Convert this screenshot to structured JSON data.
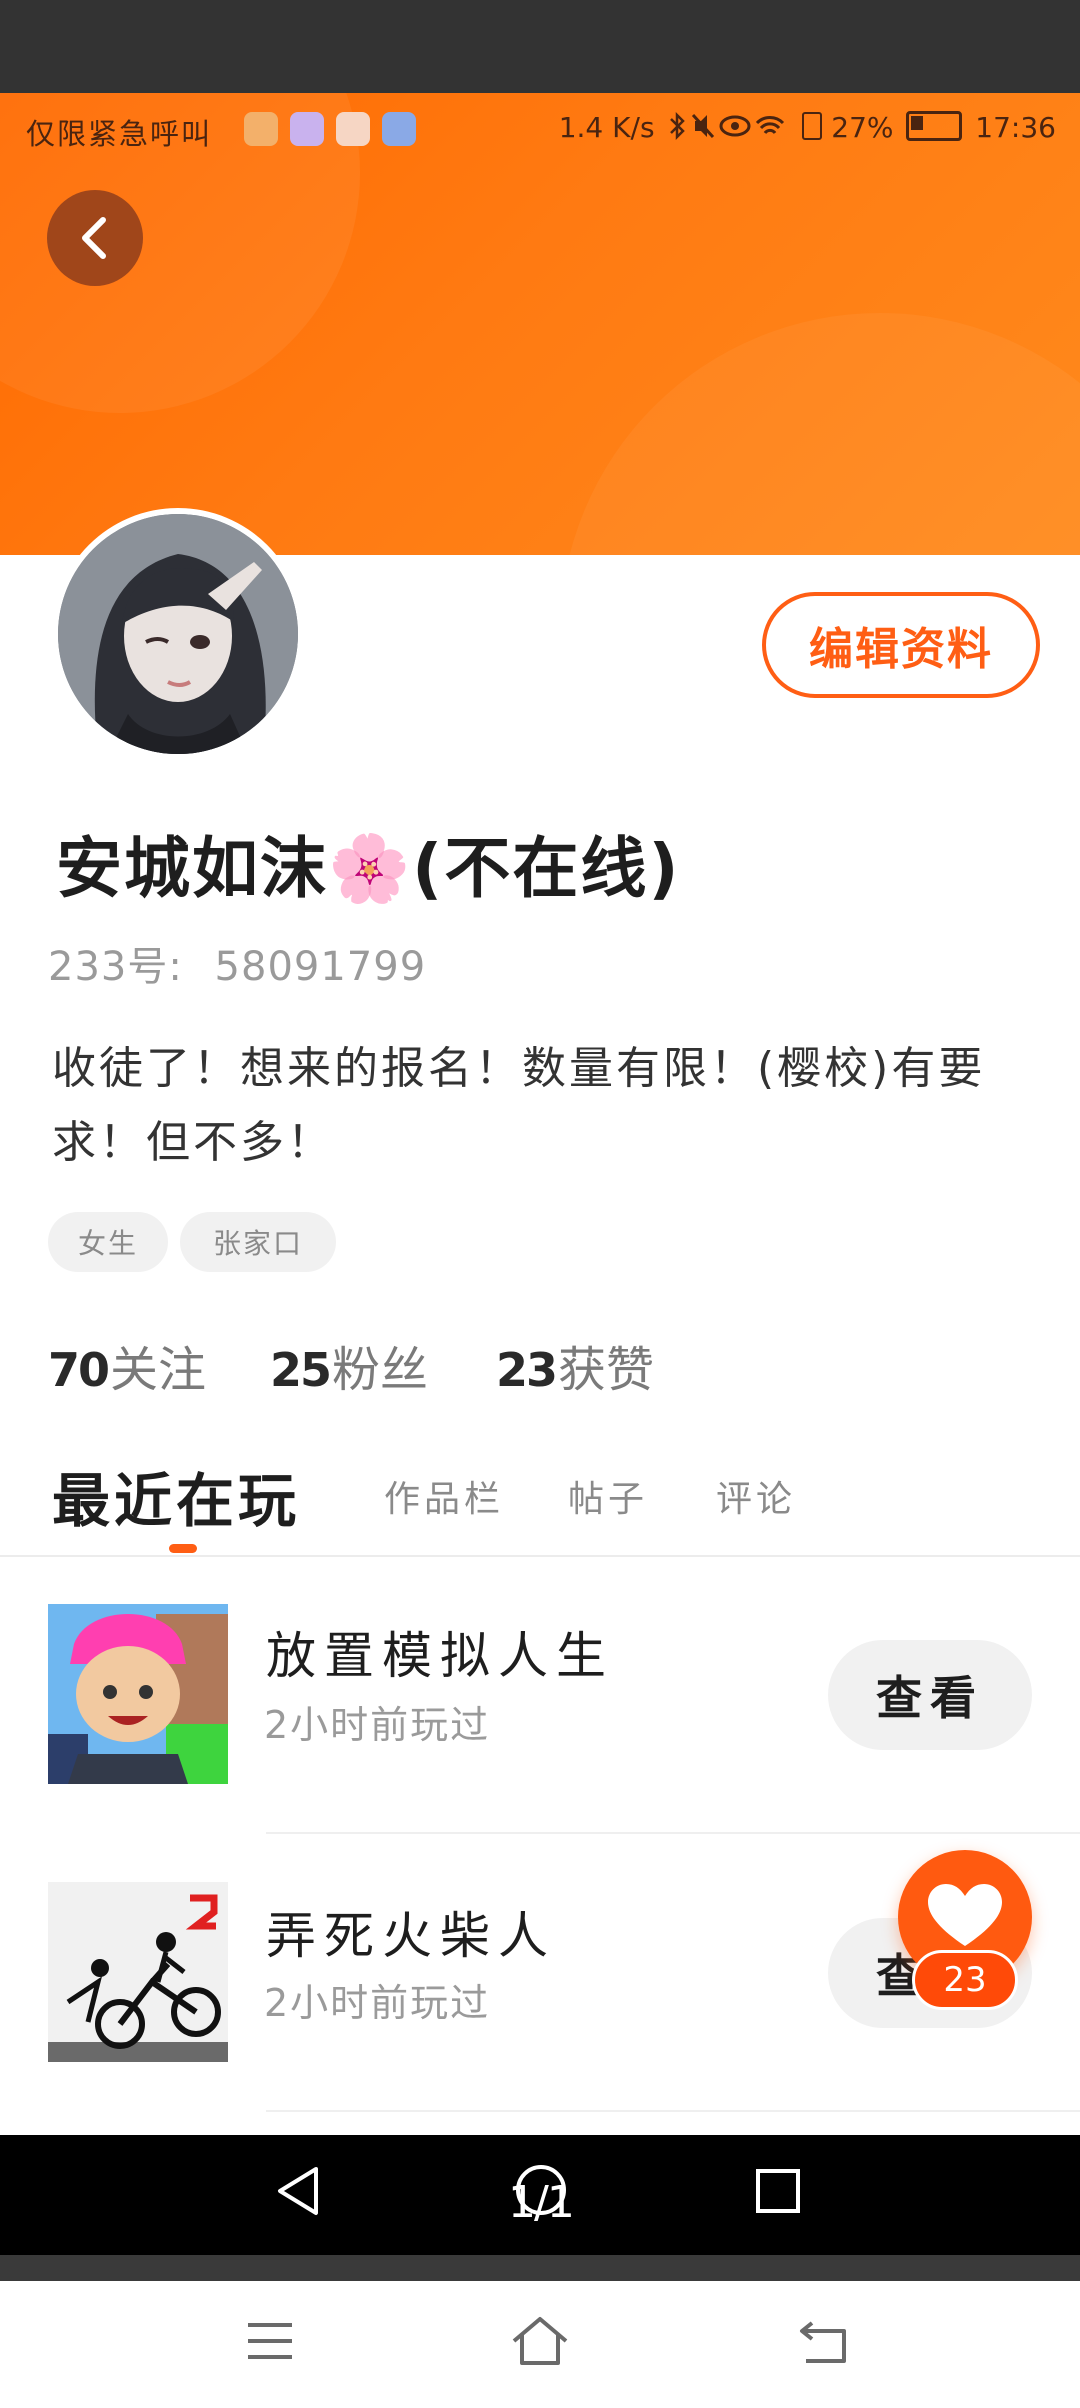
{
  "status_bar": {
    "left_text": "仅限紧急呼叫",
    "speed": "1.4 K/s",
    "battery": "27%",
    "time": "17:36"
  },
  "profile": {
    "edit_label": "编辑资料",
    "username": "安城如沫🌸(不在线)",
    "uid_label": "233号:",
    "uid_value": "58091799",
    "bio": "收徒了！想来的报名！数量有限！(樱校)有要求！但不多！",
    "tags": [
      "女生",
      "张家口"
    ]
  },
  "stats": [
    {
      "value": "70",
      "label": "关注"
    },
    {
      "value": "25",
      "label": "粉丝"
    },
    {
      "value": "23",
      "label": "获赞"
    }
  ],
  "tabs": [
    {
      "label": "最近在玩",
      "active": true
    },
    {
      "label": "作品栏",
      "active": false
    },
    {
      "label": "帖子",
      "active": false
    },
    {
      "label": "评论",
      "active": false
    }
  ],
  "games": [
    {
      "title": "放置模拟人生",
      "subtitle": "2小时前玩过",
      "action": "查看",
      "icon": "idle-life-thumbnail"
    },
    {
      "title": "弄死火柴人",
      "subtitle": "2小时前玩过",
      "action": "查看",
      "icon": "stickman-thumbnail"
    }
  ],
  "like_fab": {
    "count": "23",
    "icon": "heart-icon"
  },
  "nav": {
    "page_indicator": "1/1"
  },
  "colors": {
    "accent": "#ff5e14",
    "header_gradient_start": "#ff6a00",
    "header_gradient_end": "#ff8a1c"
  }
}
